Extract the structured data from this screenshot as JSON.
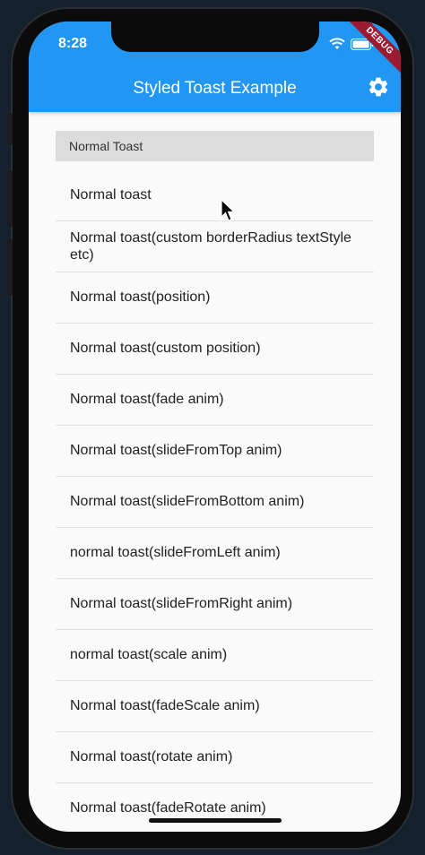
{
  "status_bar": {
    "time": "8:28"
  },
  "debug_banner": "DEBUG",
  "app_bar": {
    "title": "Styled Toast Example"
  },
  "section_header": "Normal Toast",
  "items": [
    "Normal toast",
    "Normal toast(custom borderRadius textStyle etc)",
    "Normal toast(position)",
    "Normal toast(custom position)",
    "Normal toast(fade anim)",
    "Normal toast(slideFromTop anim)",
    "Normal toast(slideFromBottom anim)",
    "normal toast(slideFromLeft anim)",
    "Normal toast(slideFromRight anim)",
    "normal toast(scale anim)",
    "Normal toast(fadeScale anim)",
    "Normal toast(rotate anim)",
    "Normal toast(fadeRotate anim)"
  ],
  "colors": {
    "app_bar": "#2196f3",
    "background": "#fafafa",
    "section_header_bg": "#dcdcdc",
    "debug_banner": "#9b1b30"
  }
}
